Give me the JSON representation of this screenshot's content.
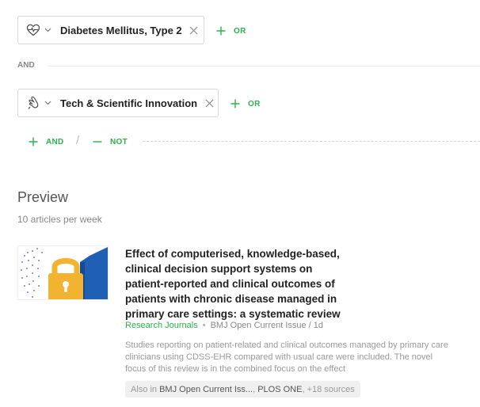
{
  "filters": {
    "group1": {
      "chip_label": "Diabetes Mellitus, Type 2",
      "icon": "heart-pulse-icon",
      "or_label": "OR"
    },
    "and_separator": "AND",
    "group2": {
      "chip_label": "Tech & Scientific Innovation",
      "icon": "hand-icon",
      "or_label": "OR"
    },
    "actions": {
      "and_label": "AND",
      "slash": "/",
      "not_label": "NOT"
    }
  },
  "preview": {
    "title": "Preview",
    "subtitle": "10 articles per week",
    "article": {
      "title": "Effect of computerised, knowledge-based, clinical decision support systems on patient-reported and clinical outcomes of patients with chronic disease managed in primary care settings: a systematic review",
      "source": "Research Journals",
      "separator": "•",
      "journal": "BMJ Open Current Issue / 1d",
      "snippet": "Studies reporting on patient-related and clinical outcomes managed by primary care clinicians using CDSS-EHR compared with usual care were included. The novel focus of this review is in the combined focus on the effect",
      "also_prefix": "Also in",
      "also_link1": "BMJ Open Current Iss...",
      "also_comma": ",",
      "also_link2": "PLOS ONE",
      "also_more": ", +18 sources"
    }
  },
  "colors": {
    "accent": "#2bb24c",
    "thumb_blue": "#1f5fb4",
    "thumb_yellow": "#f2b331"
  }
}
